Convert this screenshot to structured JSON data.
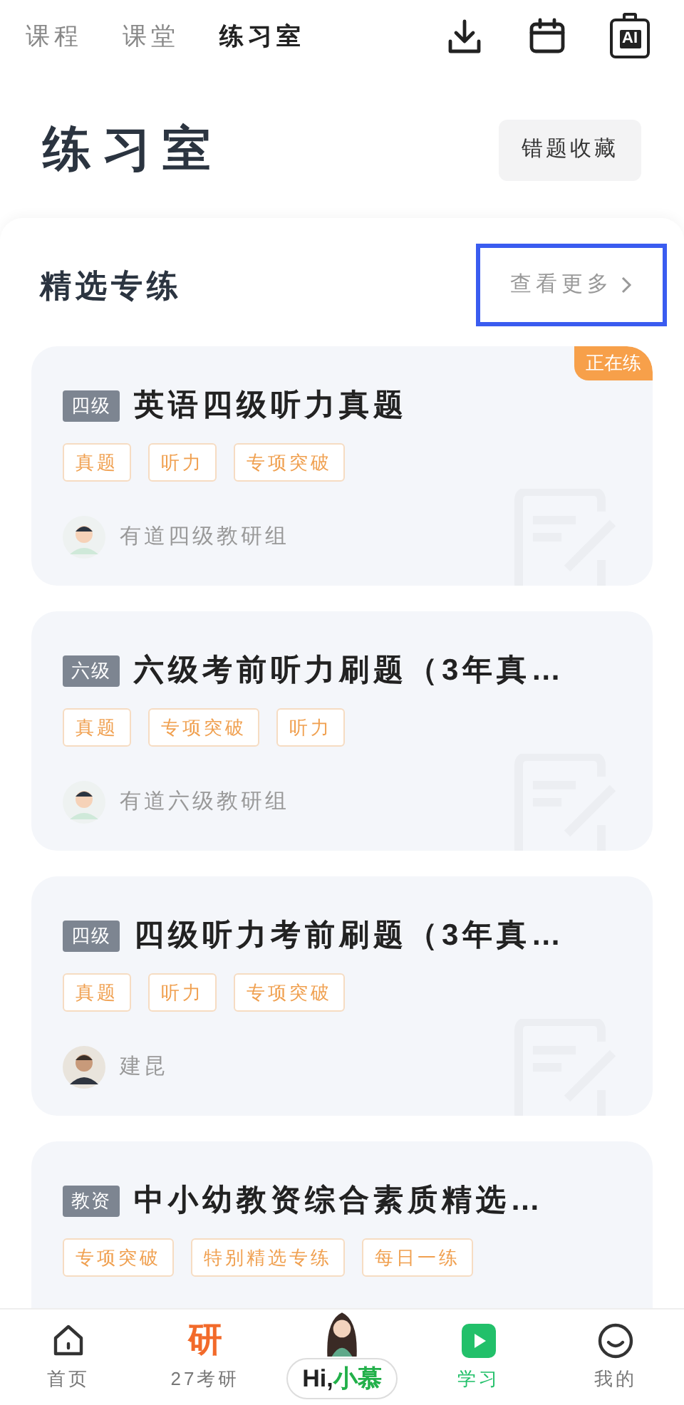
{
  "top_tabs": [
    {
      "label": "课程",
      "selected": false
    },
    {
      "label": "课堂",
      "selected": false
    },
    {
      "label": "练习室",
      "selected": true
    }
  ],
  "toolbar": {
    "ai_label": "AI"
  },
  "header": {
    "title": "练习室",
    "button": "错题收藏"
  },
  "section": {
    "title": "精选专练",
    "more": "查看更多",
    "more_highlighted": true
  },
  "cards": [
    {
      "level_tag": "四级",
      "title": "英语四级听力真题",
      "tags": [
        "真题",
        "听力",
        "专项突破"
      ],
      "author": "有道四级教研组",
      "kind": "cartoon",
      "status": "正在练"
    },
    {
      "level_tag": "六级",
      "title": "六级考前听力刷题（3年真…",
      "tags": [
        "真题",
        "专项突破",
        "听力"
      ],
      "author": "有道六级教研组",
      "kind": "cartoon"
    },
    {
      "level_tag": "四级",
      "title": "四级听力考前刷题（3年真…",
      "tags": [
        "真题",
        "听力",
        "专项突破"
      ],
      "author": "建昆",
      "kind": "photo"
    },
    {
      "level_tag": "教资",
      "title": "中小幼教资综合素质精选…",
      "tags": [
        "专项突破",
        "特别精选专练",
        "每日一练"
      ]
    }
  ],
  "bottom_nav": [
    {
      "kind": "home",
      "label": "首页",
      "selected": false
    },
    {
      "kind": "yan",
      "icon_text": "研",
      "label": "27考研",
      "selected": false
    },
    {
      "kind": "assistant",
      "label_start": "Hi,",
      "label_end": "小慕",
      "selected": false
    },
    {
      "kind": "study",
      "label": "学习",
      "selected": true
    },
    {
      "kind": "me",
      "label": "我的",
      "selected": false
    }
  ]
}
